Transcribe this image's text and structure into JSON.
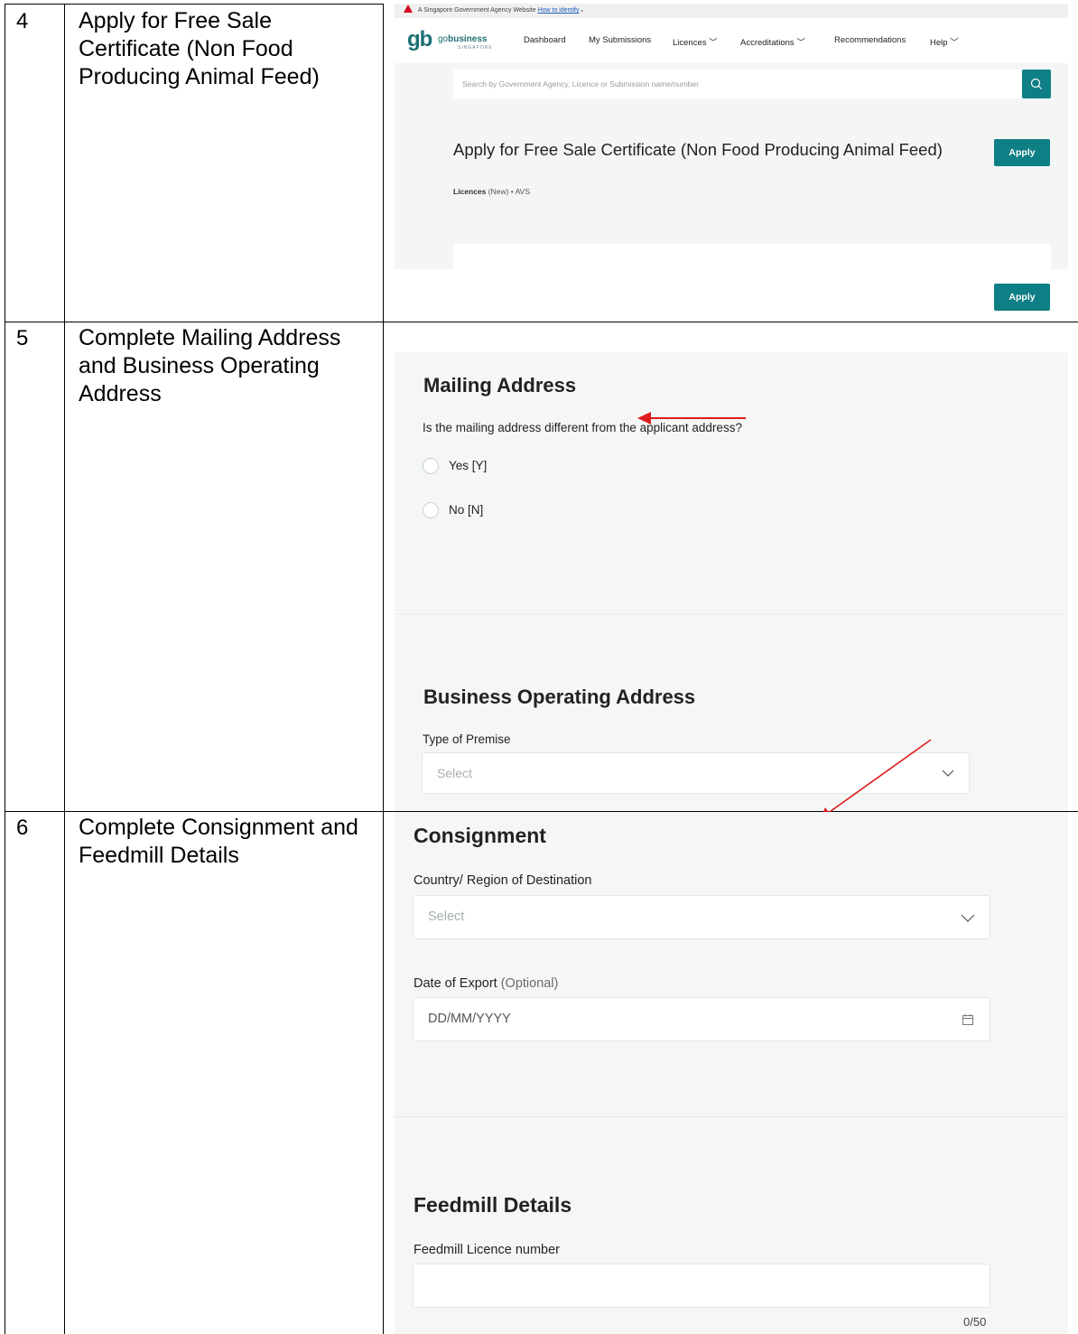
{
  "steps": [
    {
      "number": "4",
      "text": "Apply for Free Sale Certificate (Non Food Producing Animal Feed)"
    },
    {
      "number": "5",
      "text": "Complete Mailing Address and Business Operating Address"
    },
    {
      "number": "6",
      "text": "Complete Consignment and Feedmill Details"
    }
  ],
  "row4": {
    "gov_banner": "A Singapore Government Agency Website",
    "gov_link": "How to identify",
    "logo_mark": "gb",
    "logo_prefix": "go",
    "logo_bold": "business",
    "logo_sub": "SINGAPORE",
    "nav": [
      "Dashboard",
      "My Submissions",
      "Licences",
      "Accreditations",
      "Recommendations",
      "Help"
    ],
    "search_placeholder": "Search by Government Agency, Licence or Submission name/number",
    "licence_title": "Apply for Free Sale Certificate (Non Food Producing Animal Feed)",
    "meta_type": "Licences",
    "meta_rest": " (New) • AVS",
    "apply_label": "Apply",
    "apply_label_bottom": "Apply"
  },
  "row5": {
    "mailing_heading": "Mailing Address",
    "mailing_question": "Is the mailing address different from the applicant address?",
    "option_yes": "Yes [Y]",
    "option_no": "No [N]",
    "business_heading": "Business Operating Address",
    "premise_label": "Type of Premise",
    "premise_placeholder": "Select"
  },
  "row6": {
    "consignment_heading": "Consignment",
    "country_label": "Country/ Region of Destination",
    "country_placeholder": "Select",
    "date_label": "Date of Export",
    "date_optional": " (Optional)",
    "date_placeholder": "DD/MM/YYYY",
    "feedmill_heading": "Feedmill Details",
    "licence_label": "Feedmill Licence number",
    "char_counter": "0/50"
  },
  "colors": {
    "primary": "#0e7f84",
    "annotation": "#e01b1b",
    "panel": "#f5f7f7"
  }
}
